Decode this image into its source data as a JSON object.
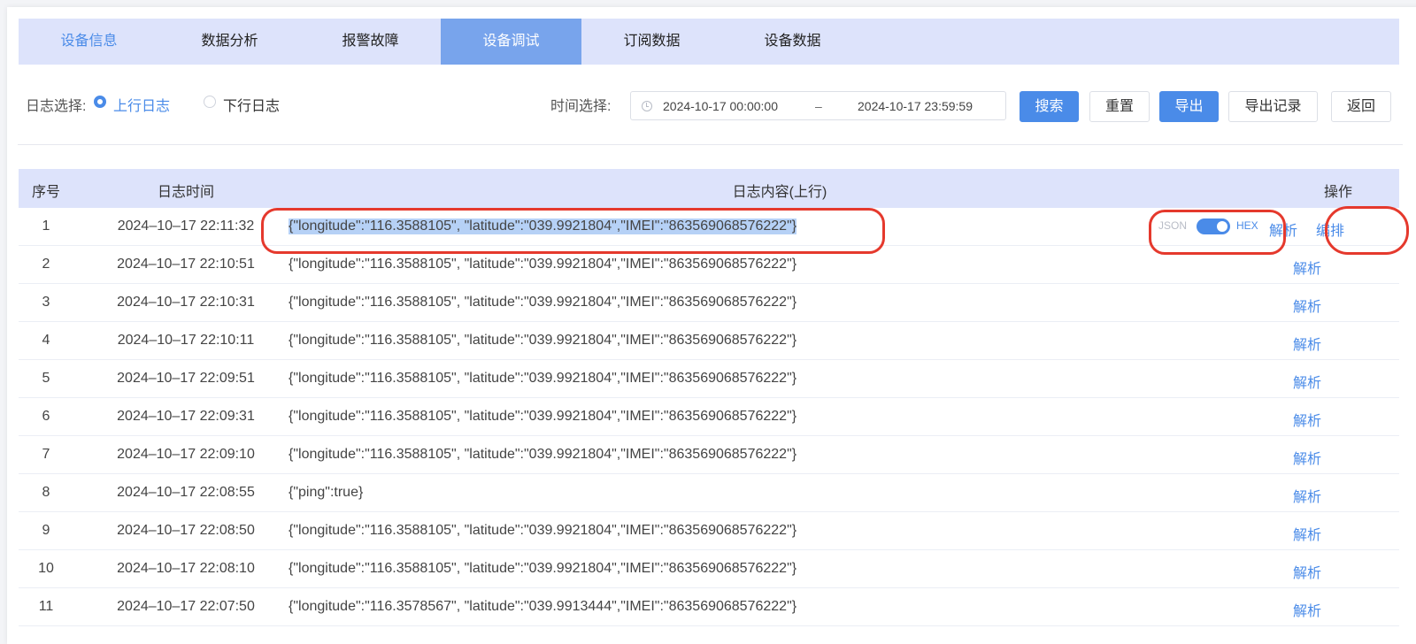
{
  "tabs": [
    {
      "label": "设备信息"
    },
    {
      "label": "数据分析"
    },
    {
      "label": "报警故障"
    },
    {
      "label": "设备调试"
    },
    {
      "label": "订阅数据"
    },
    {
      "label": "设备数据"
    }
  ],
  "active_tab": "设备调试",
  "filter": {
    "log_label": "日志选择:",
    "uplink_label": "上行日志",
    "downlink_label": "下行日志",
    "time_label": "时间选择:",
    "start_time": "2024-10-17 00:00:00",
    "range_sep": "–",
    "end_time": "2024-10-17 23:59:59",
    "search": "搜索",
    "reset": "重置",
    "export": "导出",
    "export_records": "导出记录",
    "back": "返回"
  },
  "table": {
    "headers": {
      "seq": "序号",
      "time": "日志时间",
      "content": "日志内容(上行)",
      "action": "操作"
    },
    "toggle": {
      "left": "JSON",
      "right": "HEX"
    },
    "edit_label": "编排",
    "rows": [
      {
        "seq": "1",
        "time": "2024–10–17 22:11:32",
        "content": "{\"longitude\":\"116.3588105\", \"latitude\":\"039.9921804\",\"IMEI\":\"863569068576222\"}",
        "action": "解析"
      },
      {
        "seq": "2",
        "time": "2024–10–17 22:10:51",
        "content": "{\"longitude\":\"116.3588105\", \"latitude\":\"039.9921804\",\"IMEI\":\"863569068576222\"}",
        "action": "解析"
      },
      {
        "seq": "3",
        "time": "2024–10–17 22:10:31",
        "content": "{\"longitude\":\"116.3588105\", \"latitude\":\"039.9921804\",\"IMEI\":\"863569068576222\"}",
        "action": "解析"
      },
      {
        "seq": "4",
        "time": "2024–10–17 22:10:11",
        "content": "{\"longitude\":\"116.3588105\", \"latitude\":\"039.9921804\",\"IMEI\":\"863569068576222\"}",
        "action": "解析"
      },
      {
        "seq": "5",
        "time": "2024–10–17 22:09:51",
        "content": "{\"longitude\":\"116.3588105\", \"latitude\":\"039.9921804\",\"IMEI\":\"863569068576222\"}",
        "action": "解析"
      },
      {
        "seq": "6",
        "time": "2024–10–17 22:09:31",
        "content": "{\"longitude\":\"116.3588105\", \"latitude\":\"039.9921804\",\"IMEI\":\"863569068576222\"}",
        "action": "解析"
      },
      {
        "seq": "7",
        "time": "2024–10–17 22:09:10",
        "content": "{\"longitude\":\"116.3588105\", \"latitude\":\"039.9921804\",\"IMEI\":\"863569068576222\"}",
        "action": "解析"
      },
      {
        "seq": "8",
        "time": "2024–10–17 22:08:55",
        "content": "{\"ping\":true}",
        "action": "解析"
      },
      {
        "seq": "9",
        "time": "2024–10–17 22:08:50",
        "content": "{\"longitude\":\"116.3588105\", \"latitude\":\"039.9921804\",\"IMEI\":\"863569068576222\"}",
        "action": "解析"
      },
      {
        "seq": "10",
        "time": "2024–10–17 22:08:10",
        "content": "{\"longitude\":\"116.3588105\", \"latitude\":\"039.9921804\",\"IMEI\":\"863569068576222\"}",
        "action": "解析"
      },
      {
        "seq": "11",
        "time": "2024–10–17 22:07:50",
        "content": "{\"longitude\":\"116.3578567\", \"latitude\":\"039.9913444\",\"IMEI\":\"863569068576222\"}",
        "action": "解析"
      }
    ]
  },
  "colors": {
    "accent": "#4a8be8",
    "tab_bar": "#dde3fb",
    "active_tab": "#78a4ec",
    "annotation": "#e5392d",
    "selection": "#b6d1f6"
  }
}
